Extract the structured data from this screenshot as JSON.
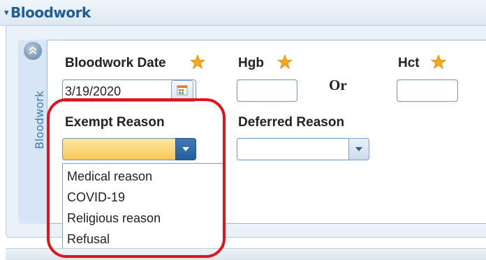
{
  "section": {
    "title": "Bloodwork",
    "collapse_glyph": "▾"
  },
  "panel": {
    "vertical_tab_label": "Bloodwork",
    "collapse_icon": "double-chevron-up-icon"
  },
  "fields": {
    "bloodwork_date": {
      "label": "Bloodwork Date",
      "value": "3/19/2020",
      "required": true
    },
    "hgb": {
      "label": "Hgb",
      "value": "",
      "required": true
    },
    "or_text": "Or",
    "hct": {
      "label": "Hct",
      "value": "",
      "required": true
    },
    "exempt_reason": {
      "label": "Exempt Reason",
      "selected": ""
    },
    "deferred_reason": {
      "label": "Deferred Reason",
      "selected": ""
    }
  },
  "exempt_options": [
    "Medical reason",
    "COVID-19",
    "Religious reason",
    "Refusal"
  ],
  "colors": {
    "accent": "#1f5d95",
    "star": "#f5a623",
    "highlight": "#e2141b",
    "combo_selected_fill": "#fcd46a"
  }
}
